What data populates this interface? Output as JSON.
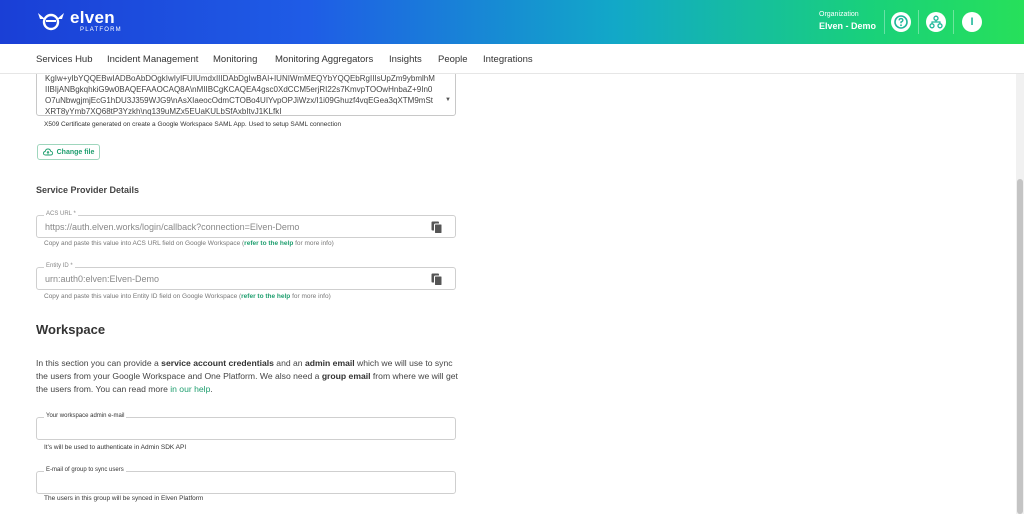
{
  "header": {
    "logo_name": "elven",
    "logo_sub": "PLATFORM",
    "org_label": "Organization",
    "org_name": "Elven - Demo",
    "buttons": [
      {
        "icon": "help-circle-icon"
      },
      {
        "icon": "hierarchy-icon"
      },
      {
        "icon": "user-avatar-icon",
        "label": "I"
      }
    ]
  },
  "nav": {
    "items": [
      "Services Hub",
      "Incident Management",
      "Monitoring",
      "Monitoring Aggregators",
      "Insights",
      "People",
      "Integrations"
    ]
  },
  "certificate": {
    "value": "KgIw+yIbYQQEBwIADBoAbDOgkIwIyIFUIUmdxIIIDAbDgIwBAI+IUNIWmMEQYbYQQEbRgIIIsUpZm9ybmlhMIIBIjANBgkqhkiG9w0BAQEFAAOCAQ8A\\nMIIBCgKCAQEA4gsc0XdCCM5erjRI22s7KmvpTOOwHnbaZ+9In0O7uNbwgjmjEcG1hDU3J359WJG9\\nAsXIaeocOdmCTOBo4UIYvpOPJiWzx/I1i09Ghuzf4vqEGea3qXTM9mStXRT8yYmb7XQ68tP3Yzkh\\nq139uMZx5EUaKULbSfAxbItvJ1KLfkI",
    "helper": "X509 Certificate generated on create a Google Workspace SAML App. Used to setup SAML connection",
    "change_file_label": "Change file"
  },
  "service_provider": {
    "title": "Service Provider Details",
    "acs": {
      "label": "ACS URL *",
      "value": "https://auth.elven.works/login/callback?connection=Elven-Demo",
      "helper_prefix": "Copy and paste this value into ACS URL field on Google Workspace (",
      "helper_link": "refer to the help",
      "helper_suffix": " for more info)"
    },
    "entity": {
      "label": "Entity ID *",
      "value": "urn:auth0:elven:Elven-Demo",
      "helper_prefix": "Copy and paste this value into Entity ID field on Google Workspace (",
      "helper_link": "refer to the help",
      "helper_suffix": " for more info)"
    }
  },
  "workspace": {
    "title": "Workspace",
    "para": {
      "t1": "In this section you can provide a ",
      "b1": "service account credentials",
      "t2": " and an ",
      "b2": "admin email",
      "t3": " which we will use to sync the users from your Google Workspace and One Platform. We also need a ",
      "b3": "group email",
      "t4": " from where we will get the users from. You can read more ",
      "link": "in our help",
      "t5": "."
    },
    "admin_email": {
      "label": "Your workspace admin e-mail",
      "helper": "It's will be used to authenticate in Admin SDK API"
    },
    "group_email": {
      "label": "E-mail of group to sync users",
      "helper": "The users in this group will be synced in Elven Platform"
    }
  },
  "colors": {
    "accent": "#1e9e6e",
    "header_start": "#1a3fd6",
    "header_end": "#27e05a"
  }
}
